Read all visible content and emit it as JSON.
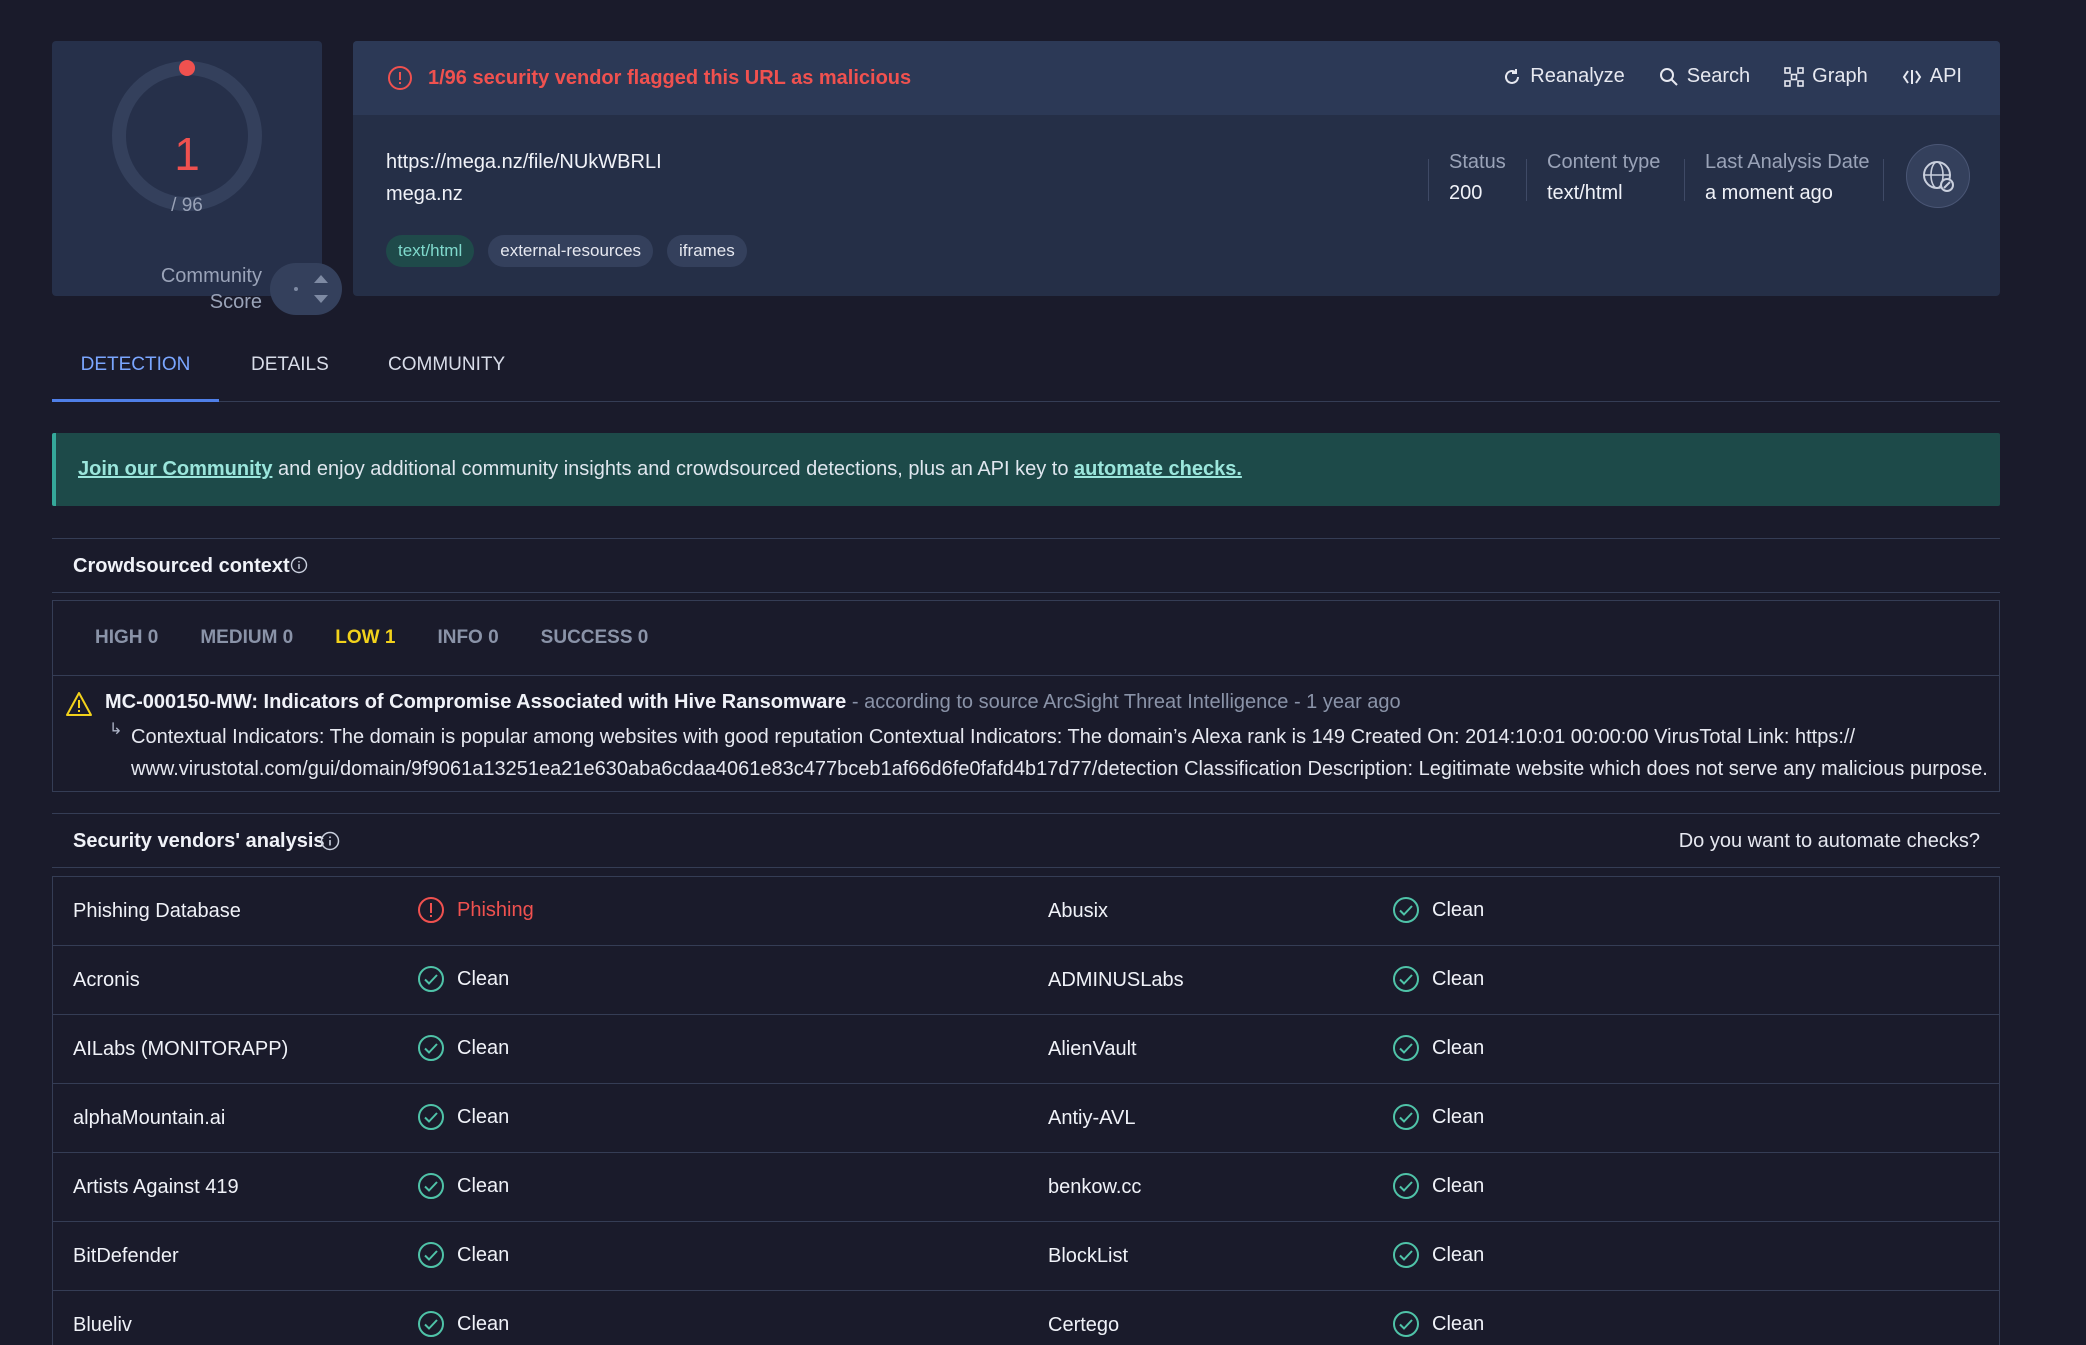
{
  "score": {
    "value": "1",
    "total": "/ 96",
    "community_label_1": "Community",
    "community_label_2": "Score",
    "ring_fraction": 0.0104,
    "color_flag": "#f0514f"
  },
  "alert": {
    "text": "1/96 security vendor flagged this URL as malicious"
  },
  "actions": [
    {
      "label": "Reanalyze",
      "icon": "refresh-icon"
    },
    {
      "label": "Search",
      "icon": "search-icon"
    },
    {
      "label": "Graph",
      "icon": "graph-icon"
    },
    {
      "label": "API",
      "icon": "api-icon"
    }
  ],
  "target": {
    "url": "https://mega.nz/file/NUkWBRLI",
    "domain": "mega.nz"
  },
  "tags": [
    "text/html",
    "external-resources",
    "iframes"
  ],
  "meta": [
    {
      "key": "Status",
      "value": "200"
    },
    {
      "key": "Content type",
      "value": "text/html"
    },
    {
      "key": "Last Analysis Date",
      "value": "a moment ago"
    }
  ],
  "tabs": [
    "DETECTION",
    "DETAILS",
    "COMMUNITY"
  ],
  "banner": {
    "link1": "Join our Community",
    "middle": " and enjoy additional community insights and crowdsourced detections, plus an API key to ",
    "link2": "automate checks."
  },
  "crowdsourced": {
    "title": "Crowdsourced context",
    "severity_tabs": [
      "HIGH 0",
      "MEDIUM 0",
      "LOW 1",
      "INFO 0",
      "SUCCESS 0"
    ],
    "entry_title": "MC-000150-MW: Indicators of Compromise Associated with Hive Ransomware",
    "entry_source": " - according to source ArcSight Threat Intelligence - 1 year ago",
    "entry_body": "Contextual Indicators: The domain is popular among websites with good reputation Contextual Indicators: The domain’s Alexa rank is 149 Created On: 2014:10:01 00:00:00 VirusTotal Link: https:// www.virustotal.com/gui/domain/9f9061a13251ea21e630aba6cdaa4061e83c477bceb1af66d6fe0fafd4b17d77/detection Classification Description: Legitimate website which does not serve any malicious purpose."
  },
  "vendors_section": {
    "title": "Security vendors' analysis",
    "automate_q": "Do you want to automate checks?"
  },
  "vendors": [
    {
      "left": {
        "name": "Phishing Database",
        "result": "Phishing",
        "status": "bad"
      },
      "right": {
        "name": "Abusix",
        "result": "Clean",
        "status": "clean"
      }
    },
    {
      "left": {
        "name": "Acronis",
        "result": "Clean",
        "status": "clean"
      },
      "right": {
        "name": "ADMINUSLabs",
        "result": "Clean",
        "status": "clean"
      }
    },
    {
      "left": {
        "name": "AILabs (MONITORAPP)",
        "result": "Clean",
        "status": "clean"
      },
      "right": {
        "name": "AlienVault",
        "result": "Clean",
        "status": "clean"
      }
    },
    {
      "left": {
        "name": "alphaMountain.ai",
        "result": "Clean",
        "status": "clean"
      },
      "right": {
        "name": "Antiy-AVL",
        "result": "Clean",
        "status": "clean"
      }
    },
    {
      "left": {
        "name": "Artists Against 419",
        "result": "Clean",
        "status": "clean"
      },
      "right": {
        "name": "benkow.cc",
        "result": "Clean",
        "status": "clean"
      }
    },
    {
      "left": {
        "name": "BitDefender",
        "result": "Clean",
        "status": "clean"
      },
      "right": {
        "name": "BlockList",
        "result": "Clean",
        "status": "clean"
      }
    },
    {
      "left": {
        "name": "Blueliv",
        "result": "Clean",
        "status": "clean"
      },
      "right": {
        "name": "Certego",
        "result": "Clean",
        "status": "clean"
      }
    }
  ]
}
